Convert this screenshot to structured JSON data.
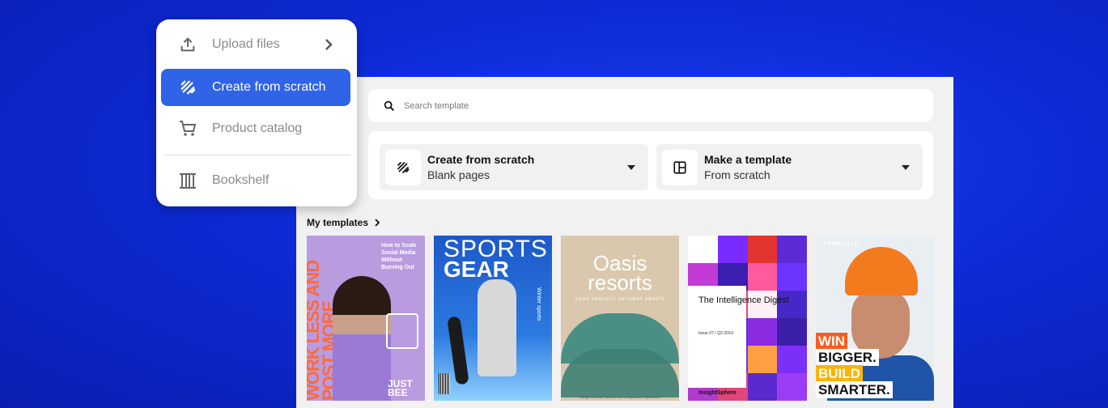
{
  "menu": {
    "items": [
      {
        "label": "Upload files",
        "icon": "upload-icon"
      },
      {
        "label": "Create from scratch",
        "icon": "pen-scribble-icon",
        "active": true
      },
      {
        "label": "Product catalog",
        "icon": "cart-icon"
      },
      {
        "label": "Bookshelf",
        "icon": "bookshelf-icon"
      }
    ]
  },
  "search": {
    "placeholder": "Search template"
  },
  "choices": [
    {
      "title": "Create from scratch",
      "subtitle": "Blank pages",
      "icon": "pen-scribble-icon"
    },
    {
      "title": "Make a template",
      "subtitle": "From scratch",
      "icon": "layout-icon"
    }
  ],
  "my_templates": {
    "label": "My templates"
  },
  "cards": {
    "c1": {
      "vertical": "WORK LESS AND POST MORE",
      "small": "How to Scale Social Media Without Burning Out",
      "brand": "JUST BEE"
    },
    "c2": {
      "line1": "SPORTS",
      "line2": "GEAR",
      "side": "Winter sports"
    },
    "c3": {
      "title": "Oasis resorts",
      "sub": "YOUR PERFECT GETAWAY AWAITS",
      "foot": "Indulge in luxury, comfort, and unforgettable experiences"
    },
    "c4": {
      "title": "The Intelligence Digest",
      "issue": "Issue 07 / Q3 20XX",
      "brand": "InsightSphere"
    },
    "c5": {
      "logo": "FORMANCE",
      "l1": "WIN",
      "l2": "BIGGER.",
      "l3": "BUILD",
      "l4": "SMARTER."
    }
  },
  "colors": {
    "accent": "#2f63e8",
    "background": "#0d2ad6"
  }
}
